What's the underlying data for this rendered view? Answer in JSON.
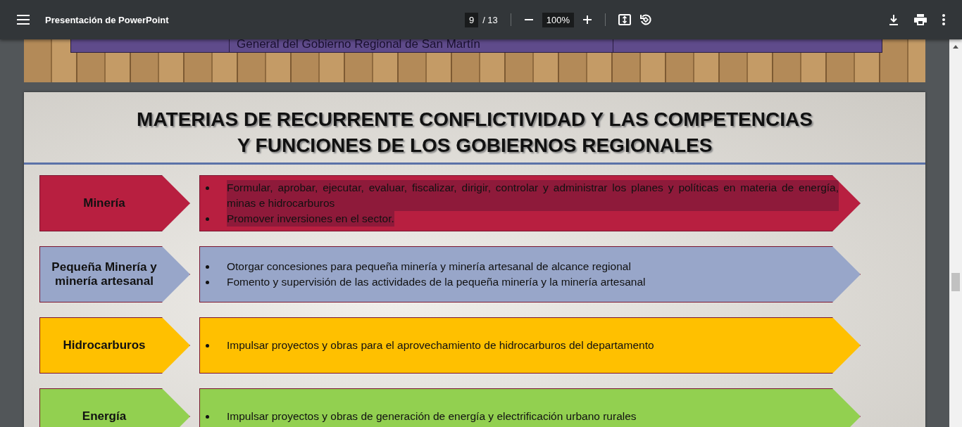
{
  "toolbar": {
    "title": "Presentación de PowerPoint",
    "page": "9",
    "page_total": "/ 13",
    "zoom": "100%"
  },
  "previous_slide": {
    "table_cell": "General del Gobierno Regional de San Martín"
  },
  "slide": {
    "title_lines": [
      "MATERIAS DE RECURRENTE CONFLICTIVIDAD Y LAS COMPETENCIAS",
      "Y FUNCIONES DE LOS GOBIERNOS REGIONALES"
    ],
    "rows": [
      {
        "label": "Minería",
        "color": "#b81f40",
        "highlighted": true,
        "bullets": [
          "Formular, aprobar, ejecutar, evaluar, fiscalizar, dirigir, controlar y administrar los planes y políticas en materia de energía, minas e hidrocarburos",
          "Promover inversiones en el sector."
        ]
      },
      {
        "label": "Pequeña Minería y minería artesanal",
        "color": "#98a6c9",
        "highlighted": false,
        "bullets": [
          "Otorgar concesiones para pequeña minería y minería artesanal de alcance regional",
          "Fomento y supervisión de las actividades de la pequeña minería y la minería artesanal"
        ]
      },
      {
        "label": "Hidrocarburos",
        "color": "#ffc000",
        "highlighted": false,
        "bullets": [
          "Impulsar proyectos y obras para el aprovechamiento de hidrocarburos del departamento"
        ]
      },
      {
        "label": "Energía",
        "color": "#92d050",
        "highlighted": false,
        "bullets": [
          "Impulsar proyectos y obras de generación de energía y electrificación urbano rurales"
        ]
      }
    ]
  }
}
